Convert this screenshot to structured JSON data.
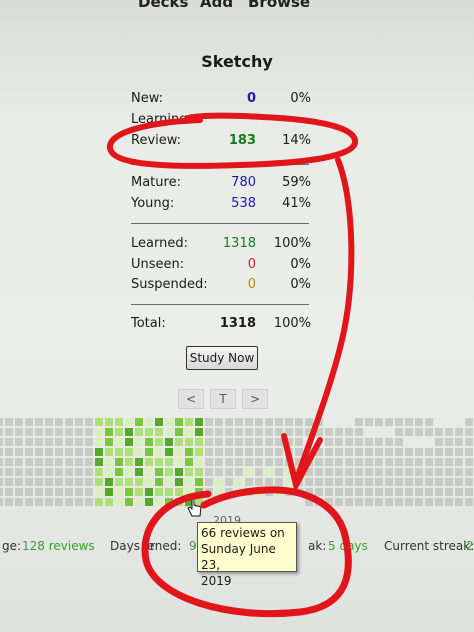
{
  "toolbar": {
    "decks": "Decks",
    "add": "Add",
    "browse": "Browse"
  },
  "deck": {
    "name": "Sketchy",
    "counts": {
      "new": {
        "label": "New:",
        "count": "0",
        "pct": "0%",
        "color": "#1a1aa8"
      },
      "learning": {
        "label": "Learning:"
      },
      "review": {
        "label": "Review:",
        "count": "183",
        "pct": "14%",
        "color": "#187a18"
      },
      "mature": {
        "label": "Mature:",
        "count": "780",
        "pct": "59%",
        "color": "#1a1aa8"
      },
      "young": {
        "label": "Young:",
        "count": "538",
        "pct": "41%",
        "color": "#1a1aa8"
      },
      "learned": {
        "label": "Learned:",
        "count": "1318",
        "pct": "100%",
        "color": "#187a18"
      },
      "unseen": {
        "label": "Unseen:",
        "count": "0",
        "pct": "0%",
        "color": "#c22"
      },
      "suspended": {
        "label": "Suspended:",
        "count": "0",
        "pct": "0%",
        "color": "#b28a00"
      },
      "total": {
        "label": "Total:",
        "count": "1318",
        "pct": "100%"
      }
    },
    "study_button": "Study Now"
  },
  "heatmap_nav": {
    "prev": "<",
    "today": "T",
    "next": ">"
  },
  "heatmap": {
    "year_label": "2019",
    "colors": {
      "empty": "#c8cac6",
      "light": "#dbeec0",
      "mid": "#aee07a",
      "strong": "#7cc63f",
      "dark": "#56a82b"
    }
  },
  "stats": {
    "average_prefix": "ge:",
    "average_value": "128 reviews",
    "days_learned_prefix": "Days le",
    "days_learned_mid": "rned:",
    "days_learned_value": "9",
    "longest_tail": "ak:",
    "longest_value": "5 days",
    "current_label": "Current streak:",
    "current_value": "2"
  },
  "tooltip": {
    "line1": "66 reviews on",
    "line2": "Sunday June 23,",
    "line3": "2019"
  },
  "annotation": {
    "color": "#e0161b"
  }
}
